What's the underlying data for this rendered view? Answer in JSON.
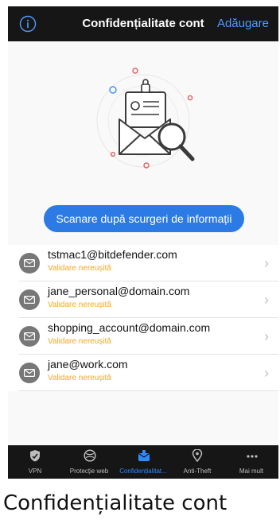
{
  "header": {
    "title": "Confidențialitate cont",
    "add_label": "Adăugare"
  },
  "hero": {
    "scan_button_label": "Scanare după scurgeri de informații"
  },
  "accounts": [
    {
      "email": "tstmac1@bitdefender.com",
      "status": "Validare nereușită"
    },
    {
      "email": "jane_personal@domain.com",
      "status": "Validare nereușită"
    },
    {
      "email": "shopping_account@domain.com",
      "status": "Validare nereușită"
    },
    {
      "email": "jane@work.com",
      "status": "Validare nereușită"
    }
  ],
  "tabs": [
    {
      "label": "VPN",
      "icon": "shield-icon"
    },
    {
      "label": "Protecție web",
      "icon": "web-protection-icon"
    },
    {
      "label": "Confidențialitat...",
      "icon": "account-privacy-icon",
      "active": true
    },
    {
      "label": "Anti-Theft",
      "icon": "location-pin-icon"
    },
    {
      "label": "Mai mult",
      "icon": "more-icon"
    }
  ],
  "caption": "Confidențialitate cont",
  "colors": {
    "accent": "#2c7be5",
    "warning": "#f5a623",
    "bar": "#161616"
  }
}
